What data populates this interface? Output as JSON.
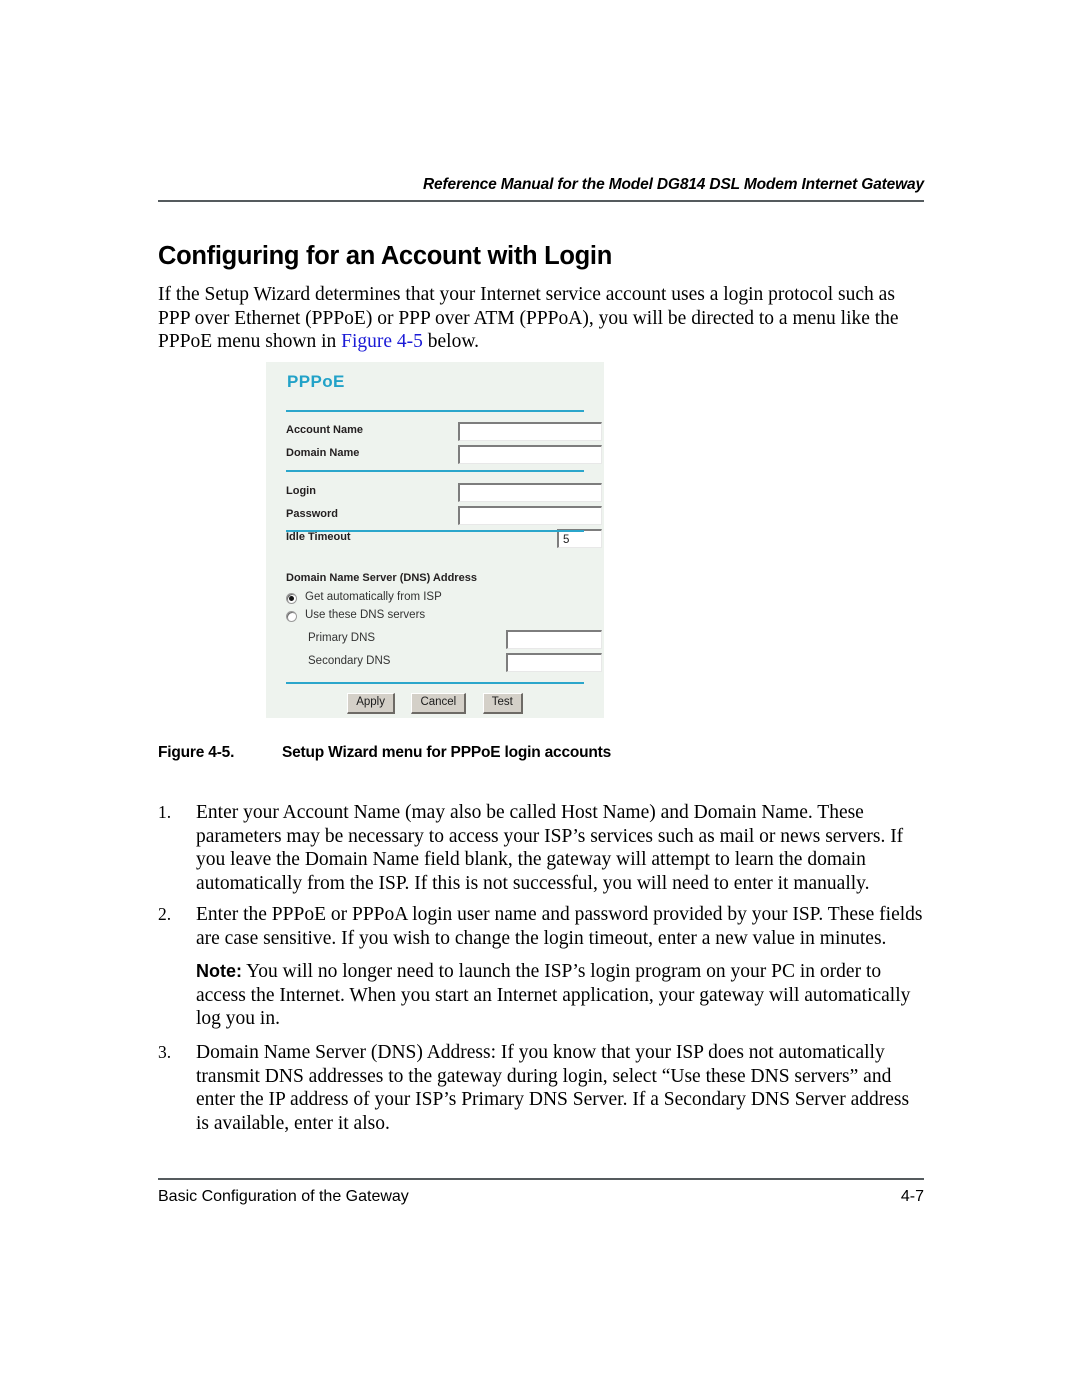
{
  "header": {
    "running_title": "Reference Manual for the Model DG814 DSL Modem Internet Gateway"
  },
  "heading": "Configuring for an Account with Login",
  "intro": {
    "before_link": "If the Setup Wizard determines that your Internet service account uses a login protocol such as PPP over Ethernet (PPPoE) or PPP over ATM (PPPoA), you will be directed to a menu like the PPPoE menu shown in ",
    "link_text": "Figure 4-5",
    "after_link": " below."
  },
  "figure": {
    "panel_title": "PPPoE",
    "fields": {
      "account_name_label": "Account Name",
      "account_name_value": "",
      "domain_name_label": "Domain Name",
      "domain_name_value": "",
      "login_label": "Login",
      "login_value": "",
      "password_label": "Password",
      "password_value": "",
      "idle_timeout_label": "Idle Timeout",
      "idle_timeout_value": "5"
    },
    "dns": {
      "section_label": "Domain Name Server (DNS) Address",
      "option_auto": "Get automatically from ISP",
      "option_manual": "Use these DNS servers",
      "selected": "auto",
      "primary_label": "Primary DNS",
      "primary_value": "",
      "secondary_label": "Secondary DNS",
      "secondary_value": ""
    },
    "buttons": {
      "apply": "Apply",
      "cancel": "Cancel",
      "test": "Test"
    },
    "accent_color": "#2ba6cb",
    "panel_background": "#eef3ee"
  },
  "caption": {
    "number": "Figure 4-5.",
    "text": "Setup Wizard menu for PPPoE login accounts"
  },
  "steps": [
    {
      "number": "1.",
      "text": "Enter your Account Name (may also be called Host Name) and Domain Name. These parameters may be necessary to access your ISP’s services such as mail or news servers. If you leave the Domain Name field blank, the gateway will attempt to learn the domain automatically from the ISP. If this is not successful, you will need to enter it manually."
    },
    {
      "number": "2.",
      "text": "Enter the PPPoE or PPPoA login user name and password provided by your ISP. These fields are case sensitive. If you wish to change the login timeout, enter a new value in minutes."
    },
    {
      "number": "3.",
      "text": "Domain Name Server (DNS) Address: If you know that your ISP does not automatically transmit DNS addresses to the gateway during login, select “Use these DNS servers” and enter the IP address of your ISP’s Primary DNS Server. If a Secondary DNS Server address is available, enter it also."
    }
  ],
  "note": {
    "label": "Note:",
    "text": " You will no longer need to launch the ISP’s login program on your PC in order to access the Internet. When you start an Internet application, your gateway will automatically log you in."
  },
  "footer": {
    "left": "Basic Configuration of the Gateway",
    "right": "4-7"
  }
}
